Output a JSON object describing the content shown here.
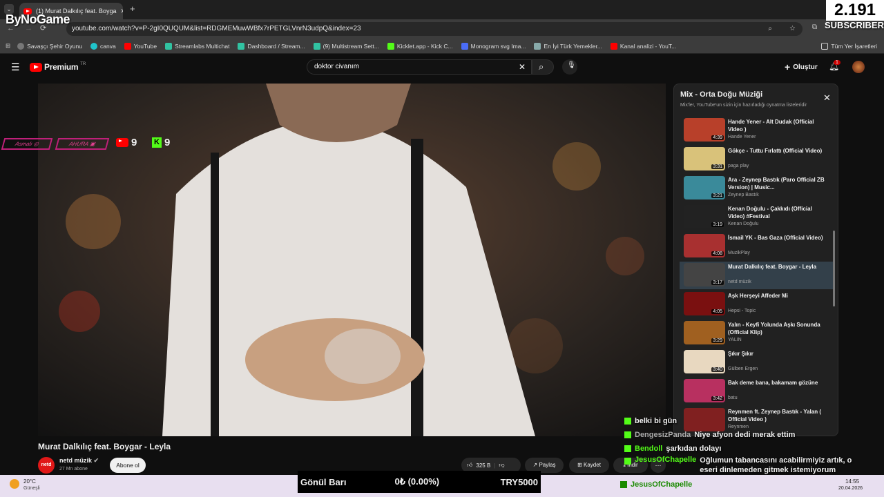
{
  "browser": {
    "tab_title": "(1) Murat Dalkılıç feat. Boyga",
    "url": "youtube.com/watch?v=P-2gI0QUQUM&list=RDGMEMuwWBfx7rPETGLVnrN3udpQ&index=23",
    "bookmarks": [
      "Savaşçı Şehir Oyunu",
      "canva",
      "YouTube",
      "Streamlabs Multichat",
      "Dashboard / Stream...",
      "(9) Multistream Sett...",
      "Kicklet.app - Kick C...",
      "Monogram svg Ima...",
      "En İyi Türk Yemekler...",
      "Kanal analizi - YouT..."
    ],
    "bookmarks_all": "Tüm Yer İşaretleri"
  },
  "stream_overlay": {
    "brand": "ByNoGame",
    "subscriber_count": "2.191",
    "subscriber_label": "SUBSCRIBER",
    "badges": [
      "Asmalı",
      "AHURA"
    ],
    "yt_count": "9",
    "kick_count": "9",
    "goal_label": "Gönül Barı",
    "goal_value": "0₺ (0.00%)",
    "goal_target": "TRY5000"
  },
  "youtube": {
    "logo": "Premium",
    "logo_sup": "TR",
    "search_value": "doktor civanım",
    "create_label": "Oluştur",
    "notif_count": "1",
    "video_title": "Murat Dalkılıç feat. Boygar - Leyla",
    "channel": "netd müzik",
    "channel_avatar": "netd",
    "subs": "27 Mn abone",
    "subscribe": "Abone ol",
    "likes": "325 B",
    "share": "Paylaş",
    "save": "Kaydet",
    "download": "İndir"
  },
  "playlist": {
    "title": "Mix - Orta Doğu Müziği",
    "subtitle": "Mix'ler, YouTube'un sizin için hazırladığı oynatma listeleridir",
    "items": [
      {
        "title": "Hande Yener - Alt Dudak (Official Video )",
        "channel": "Hande Yener",
        "dur": "4:39",
        "color": "#b8402a"
      },
      {
        "title": "Gökçe - Tuttu Fırlattı (Official Video)",
        "channel": "paga play",
        "dur": "3:31",
        "color": "#d9c27a"
      },
      {
        "title": "Ara - Zeynep Bastık (Paro Official ZB Version) | Music...",
        "channel": "Zeynep Bastık",
        "dur": "3:21",
        "color": "#3a8a9a"
      },
      {
        "title": "Kenan Doğulu - Çakkıdı (Official Video) #Festival",
        "channel": "Kenan Doğulu",
        "dur": "3:19",
        "color": "#222"
      },
      {
        "title": "İsmail YK - Bas Gaza (Official Video)",
        "channel": "MuzikPlay",
        "dur": "4:08",
        "color": "#a83030"
      },
      {
        "title": "Murat Dalkılıç feat. Boygar - Leyla",
        "channel": "netd müzik",
        "dur": "3:17",
        "color": "#444"
      },
      {
        "title": "Aşk Herşeyi Affeder Mi",
        "channel": "Hepsi - Topic",
        "dur": "4:05",
        "color": "#7a1010"
      },
      {
        "title": "Yalın - Keyfi Yolunda Aşkı Sonunda (Official Klip)",
        "channel": "YALIN",
        "dur": "3:29",
        "color": "#a06020"
      },
      {
        "title": "Şıkır Şıkır",
        "channel": "Gülben Ergen",
        "dur": "3:40",
        "color": "#e8d8c0"
      },
      {
        "title": "Bak deme bana, bakamam gözüne",
        "channel": "batu",
        "dur": "3:42",
        "color": "#b83060"
      },
      {
        "title": "Reynmen ft. Zeynep Bastık - Yalan ( Official Video )",
        "channel": "Reynmen",
        "dur": "",
        "color": "#802020"
      }
    ]
  },
  "chat": [
    {
      "user": "",
      "msg": "belki bi gün"
    },
    {
      "user": "DengesizPanda",
      "msg": "Niye afyon dedi merak ettim"
    },
    {
      "user": "Bendoll",
      "msg": "şarkıdan dolayı"
    },
    {
      "user": "JesusOfChapelle",
      "msg": "Oğlumun tabancasını acabilirmiyiz artık, o eseri dinlemeden gitmek istemiyorum"
    }
  ],
  "chat_footer_user": "JesusOfChapelle",
  "taskbar": {
    "weather": "20°C",
    "weather_desc": "Güneşli",
    "time": "14:55",
    "date": "20.04.2026"
  }
}
